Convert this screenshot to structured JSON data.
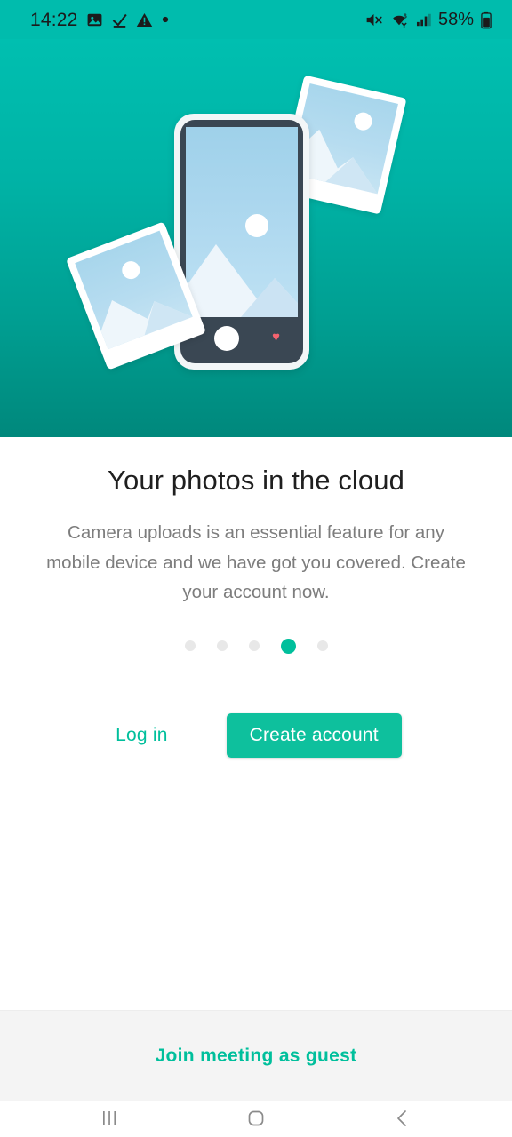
{
  "status_bar": {
    "time": "14:22",
    "battery_percent": "58%",
    "left_icons": [
      "image-icon",
      "download-complete-icon",
      "warning-triangle-icon",
      "dot-icon"
    ],
    "right_icons": [
      "mute-icon",
      "wifi-6-icon",
      "cellular-signal-icon",
      "battery-icon"
    ],
    "background_color": "#00bcad"
  },
  "hero": {
    "illustration_name": "photos-in-cloud-illustration",
    "gradient_from": "#00bfb0",
    "gradient_to": "#00887c",
    "phone": {
      "frame_color": "#f2f6f7",
      "body_color": "#3a4753",
      "heart_icon": "♥",
      "heart_color": "#f4636f"
    },
    "photo_cards": [
      {
        "name": "photo-card-top-right"
      },
      {
        "name": "photo-card-bottom-left"
      }
    ]
  },
  "main": {
    "title": "Your photos in the cloud",
    "subtitle": "Camera uploads is an essential feature for any mobile device and we have got you covered. Create your account now.",
    "pager": {
      "total": 5,
      "active_index": 3,
      "active_color": "#00bf9c",
      "inactive_color": "#e8e8e8"
    },
    "actions": {
      "login_label": "Log in",
      "create_account_label": "Create account",
      "accent_color": "#00bf9c",
      "primary_button_color": "#0ec09d"
    }
  },
  "guest": {
    "label": "Join meeting as guest",
    "color": "#00bf9c",
    "background": "#f4f4f4"
  },
  "nav_bar": {
    "items": [
      {
        "name": "recents-button",
        "icon": "recents-icon"
      },
      {
        "name": "home-button",
        "icon": "home-icon"
      },
      {
        "name": "back-button",
        "icon": "back-chevron-icon"
      }
    ]
  }
}
